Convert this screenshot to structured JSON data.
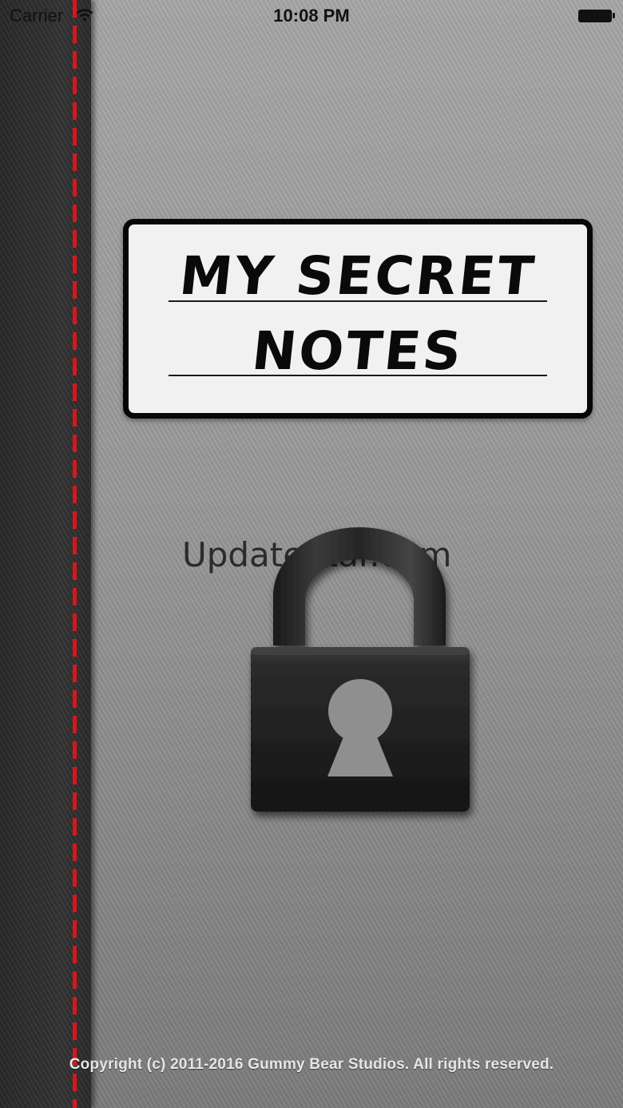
{
  "status_bar": {
    "carrier": "Carrier",
    "time": "10:08 PM",
    "wifi_icon": "wifi-icon",
    "battery_icon": "battery-icon"
  },
  "label": {
    "line1": "MY SECRET",
    "line2": "NOTES"
  },
  "watermark": {
    "text": "UpdateStar.com"
  },
  "lock": {
    "icon": "padlock-icon"
  },
  "footer": {
    "copyright": "Copyright (c) 2011-2016 Gummy Bear Studios. All rights reserved."
  },
  "colors": {
    "stitch": "#d8161b",
    "spine": "#2f2f2f",
    "cover": "#9a9a9a",
    "label_bg": "#f1f1f1",
    "label_border": "#070707"
  }
}
